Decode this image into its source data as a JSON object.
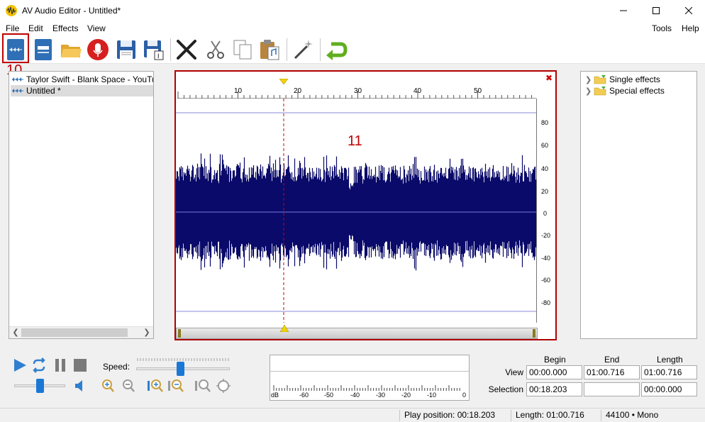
{
  "window": {
    "title": "AV Audio Editor - Untitled*"
  },
  "menu": {
    "left": [
      "File",
      "Edit",
      "Effects",
      "View"
    ],
    "right": [
      "Tools",
      "Help"
    ]
  },
  "toolbar": {
    "buttons": [
      "new-audio",
      "new-session",
      "open-file",
      "record",
      "save",
      "save-as",
      "cut",
      "scissors-cut",
      "copy",
      "paste",
      "magic-wand",
      "undo"
    ]
  },
  "annotations": {
    "toolbar_label": "10",
    "wave_label": "11"
  },
  "files": [
    {
      "name": "Taylor Swift - Blank Space - YouTube",
      "selected": false
    },
    {
      "name": "Untitled *",
      "selected": true
    }
  ],
  "ruler": {
    "ticks": [
      "10",
      "20",
      "30",
      "40",
      "50"
    ]
  },
  "amplitude_scale": [
    "80",
    "60",
    "40",
    "20",
    "0",
    "-20",
    "-40",
    "-60",
    "-80"
  ],
  "waveform": {
    "color": "#0a0a6a",
    "background": "#ffffff",
    "marker_color": "#cc0000"
  },
  "effects": [
    {
      "label": "Single effects"
    },
    {
      "label": "Special effects"
    }
  ],
  "playback": {
    "speed_label": "Speed:"
  },
  "meter": {
    "labels": [
      "dB",
      "-60",
      "-50",
      "-40",
      "-30",
      "-20",
      "-10",
      "0"
    ]
  },
  "times": {
    "headers": [
      "Begin",
      "End",
      "Length"
    ],
    "view": {
      "label": "View",
      "begin": "00:00.000",
      "end": "01:00.716",
      "length": "01:00.716"
    },
    "selection": {
      "label": "Selection",
      "begin": "00:18.203",
      "end": "",
      "length": "00:00.000"
    }
  },
  "status": {
    "play_position": "Play position: 00:18.203",
    "length": "Length: 01:00.716",
    "format": "44100 • Mono"
  },
  "colors": {
    "accent": "#1b77d6",
    "annotation": "#c00000"
  }
}
